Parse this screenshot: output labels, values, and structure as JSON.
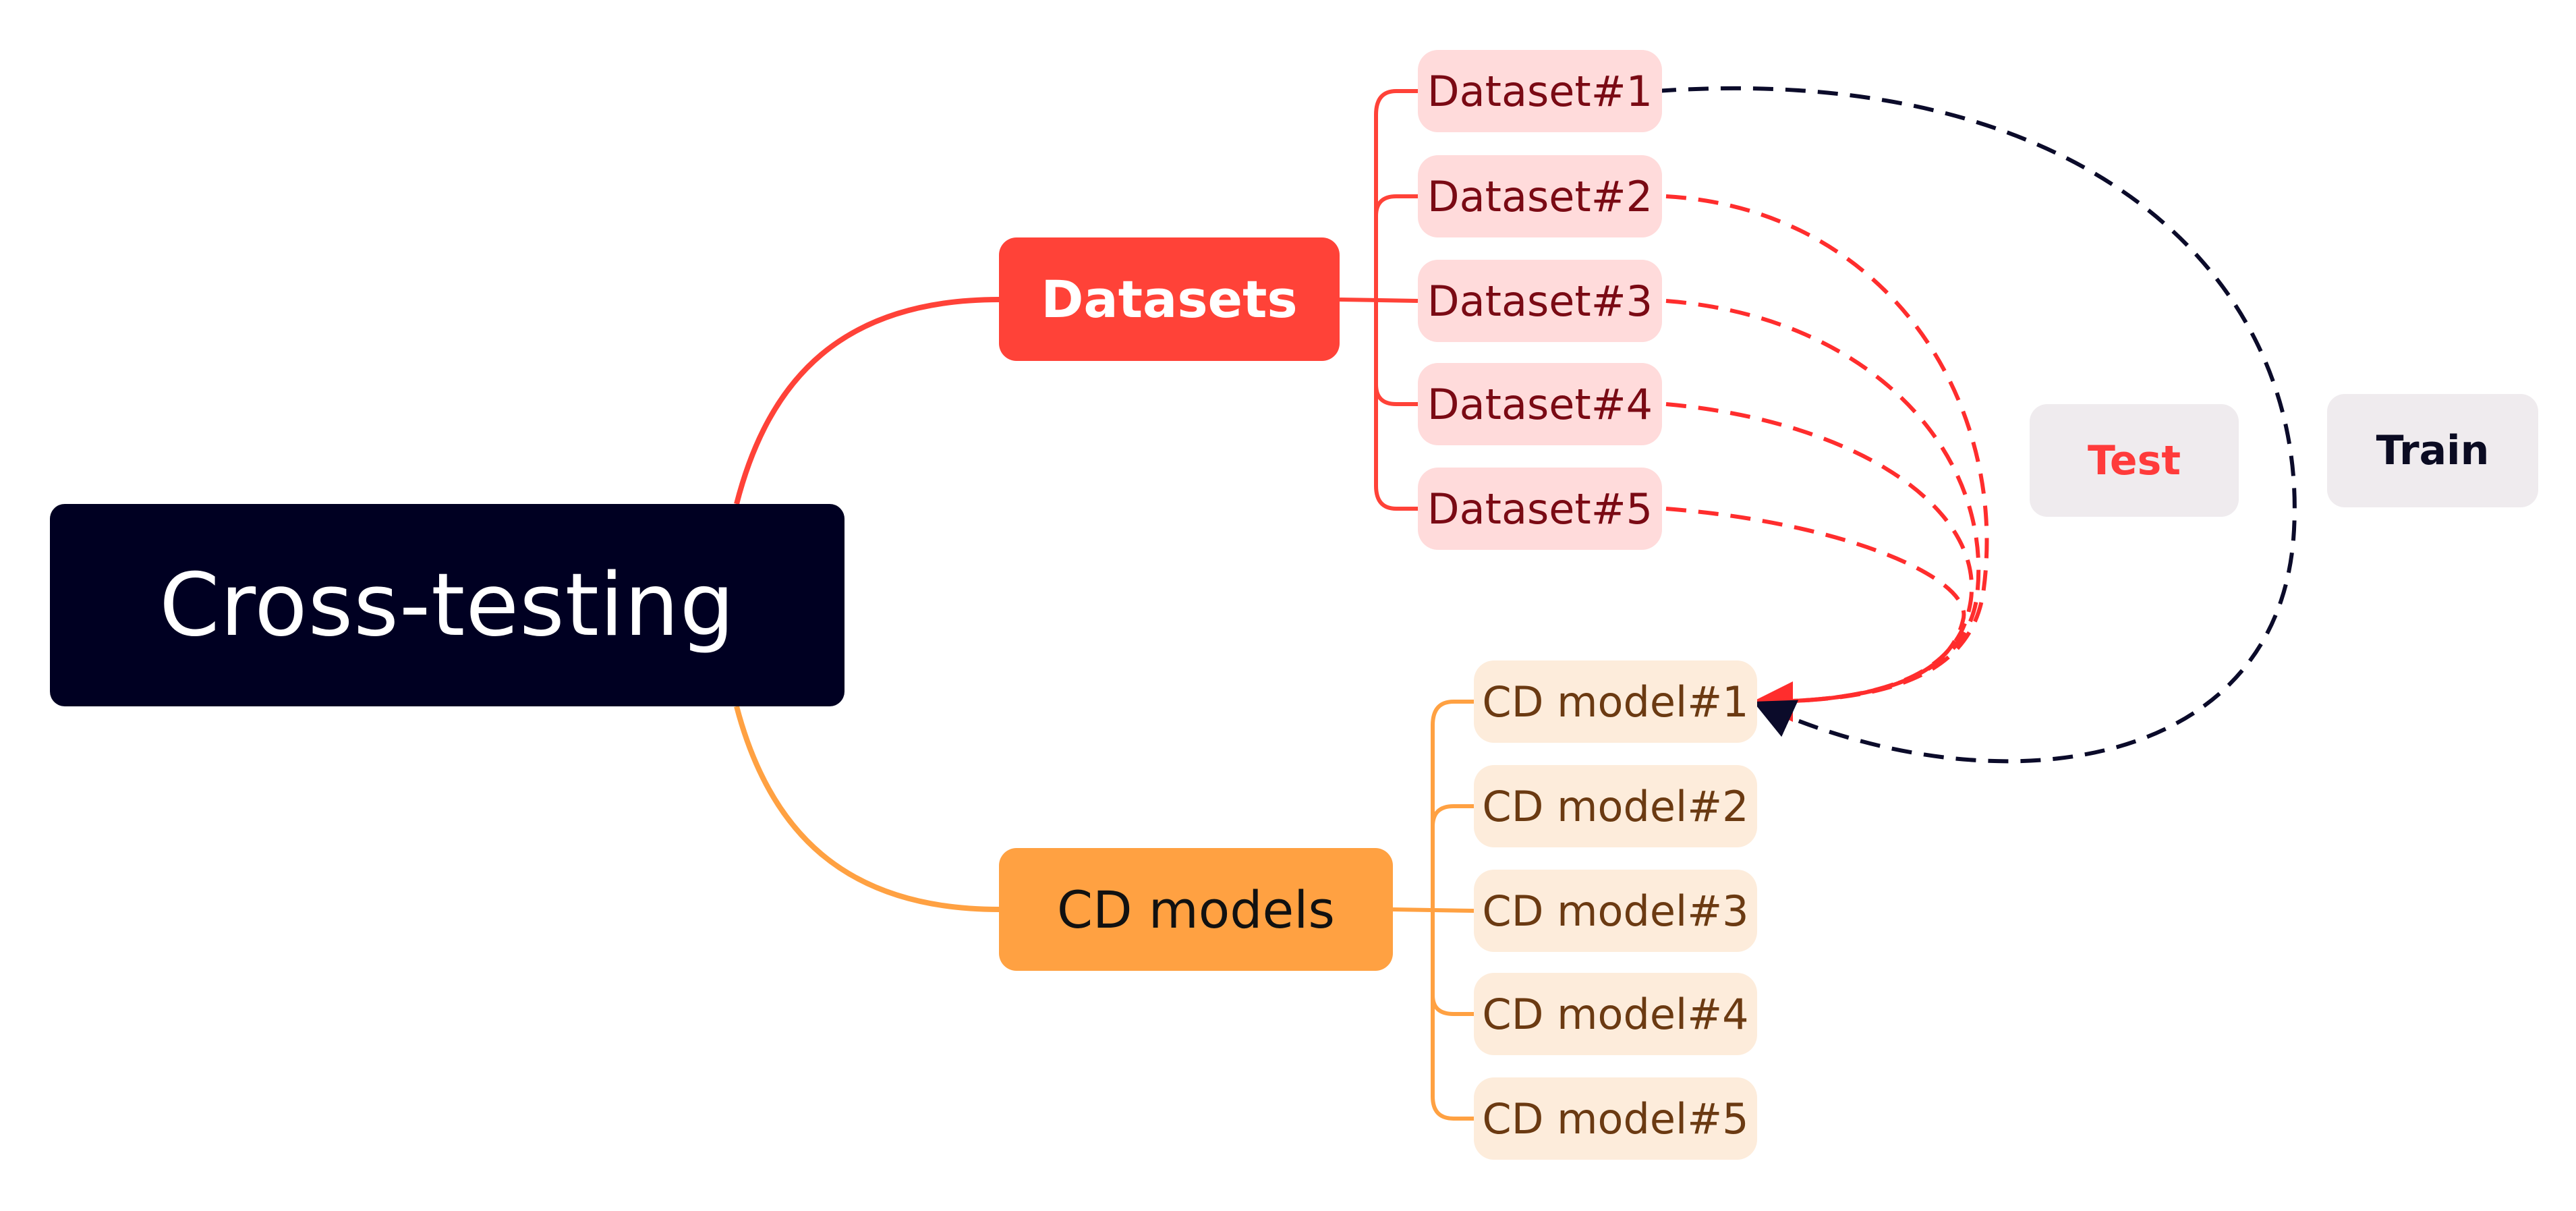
{
  "diagram": {
    "root": {
      "label": "Cross-testing",
      "color": "#000022"
    },
    "branches": [
      {
        "label": "Datasets",
        "color": "#ff4238",
        "children": [
          "Dataset#1",
          "Dataset#2",
          "Dataset#3",
          "Dataset#4",
          "Dataset#5"
        ]
      },
      {
        "label": "CD models",
        "color": "#ffa142",
        "children": [
          "CD model#1",
          "CD model#2",
          "CD model#3",
          "CD model#4",
          "CD model#5"
        ]
      }
    ],
    "relations": [
      {
        "from": "Dataset#1",
        "to": "CD model#1",
        "kind": "Train",
        "style": "dashed",
        "color": "#0b0b2a"
      },
      {
        "from": "Dataset#2",
        "to": "CD model#1",
        "kind": "Test",
        "style": "dashed",
        "color": "#ff2d2d"
      },
      {
        "from": "Dataset#3",
        "to": "CD model#1",
        "kind": "Test",
        "style": "dashed",
        "color": "#ff2d2d"
      },
      {
        "from": "Dataset#4",
        "to": "CD model#1",
        "kind": "Test",
        "style": "dashed",
        "color": "#ff2d2d"
      },
      {
        "from": "Dataset#5",
        "to": "CD model#1",
        "kind": "Test",
        "style": "dashed",
        "color": "#ff2d2d"
      }
    ],
    "legend": [
      {
        "label": "Test",
        "color": "#ff3b3b"
      },
      {
        "label": "Train",
        "color": "#0b0b22"
      }
    ]
  }
}
